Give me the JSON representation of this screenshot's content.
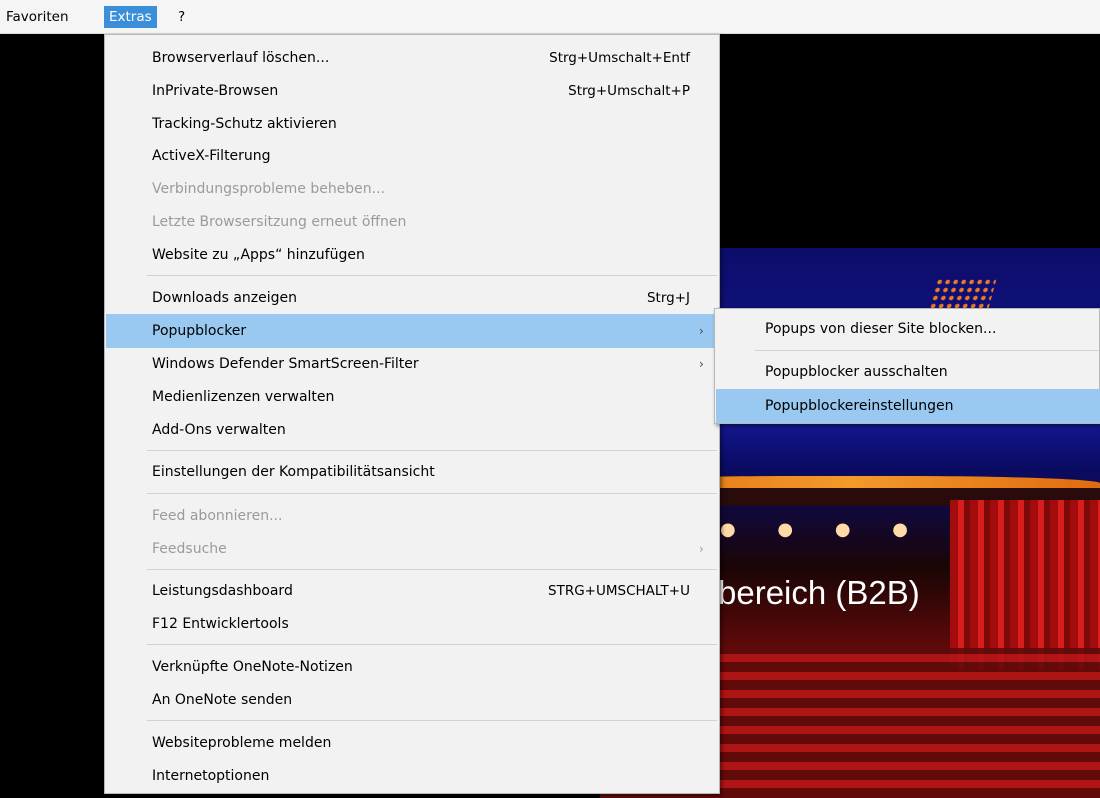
{
  "menubar": {
    "items": [
      {
        "label": "Favoriten",
        "active": false
      },
      {
        "label": "Extras",
        "active": true
      },
      {
        "label": "?",
        "active": false
      }
    ]
  },
  "menu": {
    "items": [
      {
        "label": "Browserverlauf löschen...",
        "shortcut": "Strg+Umschalt+Entf",
        "enabled": true
      },
      {
        "label": "InPrivate-Browsen",
        "shortcut": "Strg+Umschalt+P",
        "enabled": true
      },
      {
        "label": "Tracking-Schutz aktivieren",
        "enabled": true
      },
      {
        "label": "ActiveX-Filterung",
        "enabled": true
      },
      {
        "label": "Verbindungsprobleme beheben...",
        "enabled": false
      },
      {
        "label": "Letzte Browsersitzung erneut öffnen",
        "enabled": false
      },
      {
        "label": "Website zu „Apps“ hinzufügen",
        "enabled": true
      },
      {
        "label": "Downloads anzeigen",
        "shortcut": "Strg+J",
        "enabled": true
      },
      {
        "label": "Popupblocker",
        "submenu": true,
        "enabled": true,
        "highlighted": true
      },
      {
        "label": "Windows Defender SmartScreen-Filter",
        "submenu": true,
        "enabled": true
      },
      {
        "label": "Medienlizenzen verwalten",
        "enabled": true
      },
      {
        "label": "Add-Ons verwalten",
        "enabled": true
      },
      {
        "label": "Einstellungen der Kompatibilitätsansicht",
        "enabled": true
      },
      {
        "label": "Feed abonnieren...",
        "enabled": false
      },
      {
        "label": "Feedsuche",
        "submenu": true,
        "enabled": false
      },
      {
        "label": "Leistungsdashboard",
        "shortcut": "STRG+UMSCHALT+U",
        "enabled": true
      },
      {
        "label": "F12 Entwicklertools",
        "enabled": true
      },
      {
        "label": "Verknüpfte OneNote-Notizen",
        "enabled": true
      },
      {
        "label": "An OneNote senden",
        "enabled": true
      },
      {
        "label": "Websiteprobleme melden",
        "enabled": true
      },
      {
        "label": "Internetoptionen",
        "enabled": true
      }
    ],
    "submenu_arrow": "›"
  },
  "submenu": {
    "items": [
      {
        "label": "Popups von dieser Site blocken..."
      },
      {
        "label": "Popupblocker ausschalten"
      },
      {
        "label": "Popupblockereinstellungen",
        "highlighted": true
      }
    ]
  },
  "background": {
    "heading": "bereich (B2B)",
    "colors": {
      "menu_highlight": "#99c9f1",
      "menubar_active": "#3b8fd9"
    }
  }
}
